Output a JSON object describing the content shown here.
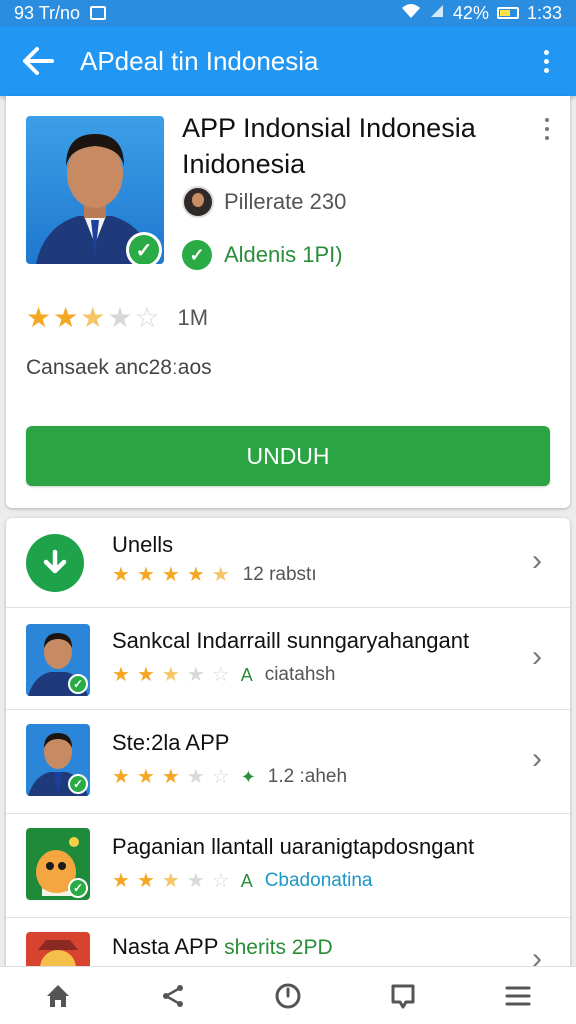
{
  "status_bar": {
    "left_text": "93 Tr/no",
    "battery": "42%",
    "time": "1:33"
  },
  "app_bar": {
    "title": "APdeal tin Indonesia",
    "back_icon": "arrow-left-icon",
    "menu_icon": "more-vert-icon"
  },
  "app_detail": {
    "title": "APP Indonsial Indonesia Inidonesia",
    "developer": "Pillerate 230",
    "verified_label": "Aldenis 1PI)",
    "rating_stars": 2.5,
    "rating_count": "1M",
    "category": "Cansaek anc28ːaos",
    "download_label": "UNDUH"
  },
  "list": [
    {
      "title": "Unells",
      "stars": 4.5,
      "sub_text": "12 rabstı",
      "sub_style": "gray",
      "icon": "download-icon"
    },
    {
      "title": "Sankcal Indarraill sunngaryahangant",
      "stars": 2.5,
      "sub_badge": "A",
      "sub_text": "ciatahsh",
      "sub_style": "gray",
      "icon": "person-app-icon"
    },
    {
      "title": "Ste:2la APP",
      "stars": 3,
      "sub_badge": "✦",
      "sub_text": "1.2 :aheh",
      "sub_style": "gray",
      "icon": "person-app-icon"
    },
    {
      "title": "Paganian llantall uaranigtapdosngant",
      "stars": 2.5,
      "sub_badge": "A",
      "sub_text": "Cbadonatina",
      "sub_style": "teal",
      "icon": "mascot-app-icon"
    },
    {
      "title": "Nasta APP",
      "title_accent": "sherits 2PD",
      "icon": "mascot-app-icon"
    }
  ],
  "bottom_nav": [
    "home-icon",
    "share-icon",
    "clock-icon",
    "chat-icon",
    "menu-icon"
  ],
  "colors": {
    "primary": "#2196f3",
    "status_bar": "#2a8de0",
    "download": "#2ba444",
    "star": "#f5a623",
    "verified": "#2bab46"
  }
}
